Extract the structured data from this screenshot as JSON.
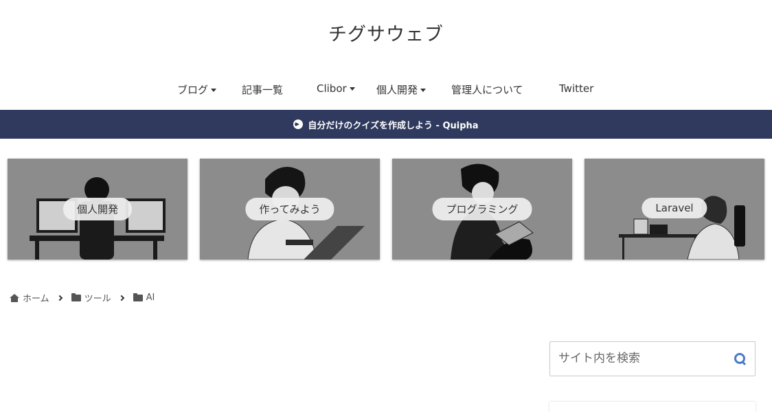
{
  "site": {
    "title": "チグサウェブ"
  },
  "nav": {
    "items": [
      {
        "label": "ブログ",
        "has_dropdown": true
      },
      {
        "label": "記事一覧",
        "has_dropdown": false
      },
      {
        "label": "Clibor",
        "has_dropdown": true
      },
      {
        "label": "個人開発",
        "has_dropdown": true
      },
      {
        "label": "管理人について",
        "has_dropdown": false
      },
      {
        "label": "Twitter",
        "has_dropdown": false
      }
    ]
  },
  "banner": {
    "text": "自分だけのクイズを作成しよう - Quipha",
    "icon": "arrow-circle-right-icon",
    "color": "#2f3a5e"
  },
  "cards": [
    {
      "label": "個人開発"
    },
    {
      "label": "作ってみよう"
    },
    {
      "label": "プログラミング"
    },
    {
      "label": "Laravel"
    }
  ],
  "breadcrumb": [
    {
      "label": "ホーム",
      "icon": "home-icon"
    },
    {
      "label": "ツール",
      "icon": "folder-icon"
    },
    {
      "label": "AI",
      "icon": "folder-icon"
    }
  ],
  "search": {
    "placeholder": "サイト内を検索",
    "value": "",
    "icon": "search-icon",
    "accent": "#4a7ac8"
  }
}
